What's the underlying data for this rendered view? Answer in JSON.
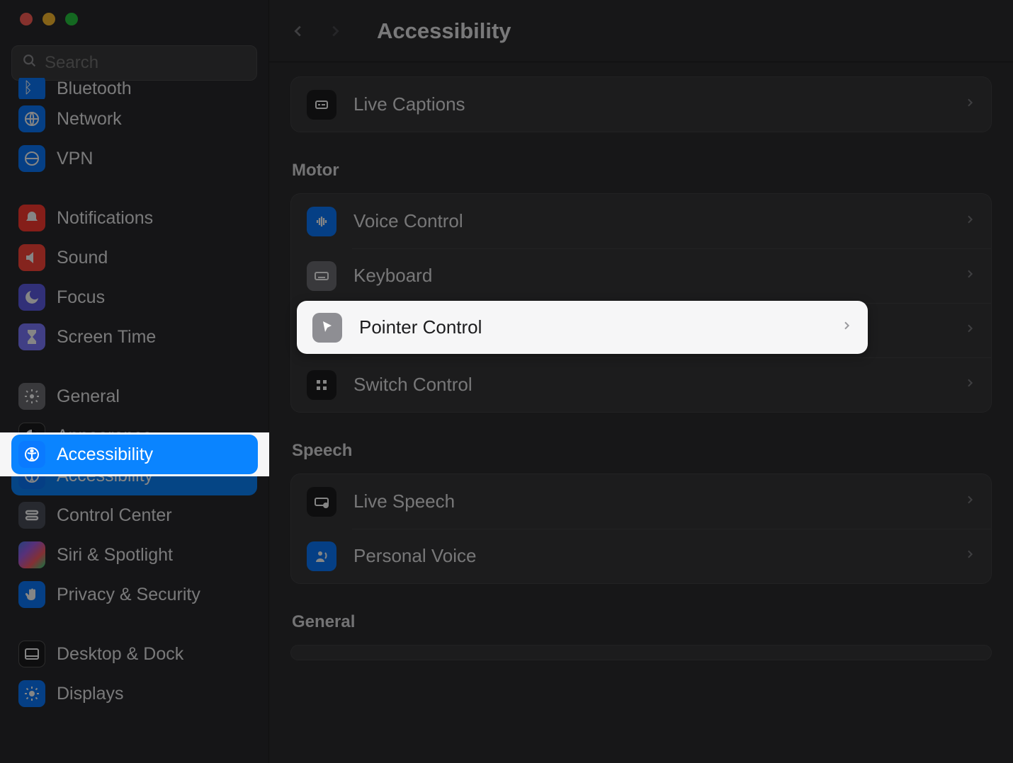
{
  "window": {
    "title": "Accessibility"
  },
  "search": {
    "placeholder": "Search"
  },
  "sidebar": {
    "groups": [
      {
        "items": [
          {
            "label": "Bluetooth",
            "id": "bluetooth",
            "icon": "bluetooth-icon",
            "color": "ic-blue"
          },
          {
            "label": "Network",
            "id": "network",
            "icon": "globe-icon",
            "color": "ic-blue"
          },
          {
            "label": "VPN",
            "id": "vpn",
            "icon": "globe-icon",
            "color": "ic-blue"
          }
        ]
      },
      {
        "items": [
          {
            "label": "Notifications",
            "id": "notifications",
            "icon": "bell-icon",
            "color": "ic-reddish"
          },
          {
            "label": "Sound",
            "id": "sound",
            "icon": "sound-icon",
            "color": "ic-red"
          },
          {
            "label": "Focus",
            "id": "focus",
            "icon": "moon-icon",
            "color": "ic-purple"
          },
          {
            "label": "Screen Time",
            "id": "screen-time",
            "icon": "hourglass-icon",
            "color": "ic-lilac"
          }
        ]
      },
      {
        "items": [
          {
            "label": "General",
            "id": "general",
            "icon": "gear-icon",
            "color": "ic-gray"
          },
          {
            "label": "Appearance",
            "id": "appearance",
            "icon": "contrast-icon",
            "color": "ic-black"
          },
          {
            "label": "Accessibility",
            "id": "accessibility",
            "icon": "accessibility-icon",
            "color": "ic-blue2",
            "selected": true
          },
          {
            "label": "Control Center",
            "id": "control-center",
            "icon": "switches-icon",
            "color": "ic-slate"
          },
          {
            "label": "Siri & Spotlight",
            "id": "siri-spotlight",
            "icon": "siri-icon",
            "color": "ic-siri"
          },
          {
            "label": "Privacy & Security",
            "id": "privacy-security",
            "icon": "hand-icon",
            "color": "ic-blue"
          }
        ]
      },
      {
        "items": [
          {
            "label": "Desktop & Dock",
            "id": "desktop-dock",
            "icon": "dock-icon",
            "color": "ic-black"
          },
          {
            "label": "Displays",
            "id": "displays",
            "icon": "brightness-icon",
            "color": "ic-blue"
          }
        ]
      }
    ]
  },
  "main": {
    "hearing_tail": {
      "live_captions": "Live Captions"
    },
    "sections": [
      {
        "title": "Motor",
        "rows": [
          {
            "label": "Voice Control",
            "id": "voice-control",
            "icon": "voice-icon",
            "color": "r-blue"
          },
          {
            "label": "Keyboard",
            "id": "keyboard",
            "icon": "keyboard-icon",
            "color": "r-gray"
          },
          {
            "label": "Pointer Control",
            "id": "pointer-control",
            "icon": "pointer-icon",
            "color": "r-gray",
            "highlighted": true
          },
          {
            "label": "Switch Control",
            "id": "switch-control",
            "icon": "grid-icon",
            "color": "r-black"
          }
        ]
      },
      {
        "title": "Speech",
        "rows": [
          {
            "label": "Live Speech",
            "id": "live-speech",
            "icon": "keyboard-speech-icon",
            "color": "r-black"
          },
          {
            "label": "Personal Voice",
            "id": "personal-voice",
            "icon": "person-voice-icon",
            "color": "r-blue"
          }
        ]
      },
      {
        "title": "General",
        "rows": []
      }
    ]
  }
}
